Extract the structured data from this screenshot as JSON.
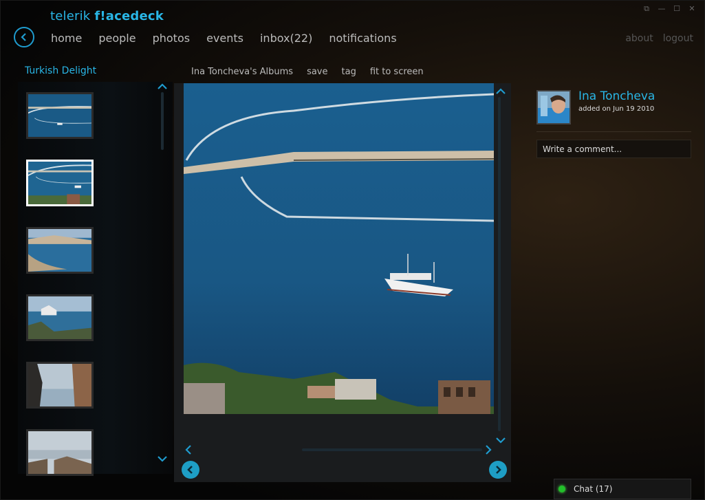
{
  "app": {
    "brand_prefix": "telerik ",
    "brand_name": "f!acedeck"
  },
  "nav": {
    "items": [
      "home",
      "people",
      "photos",
      "events",
      "inbox(22)",
      "notifications"
    ],
    "right": [
      "about",
      "logout"
    ]
  },
  "album": {
    "title": "Turkish Delight",
    "selected_index": 1
  },
  "toolbar": {
    "albums_link": "Ina Toncheva's Albums",
    "save": "save",
    "tag": "tag",
    "fit": "fit to screen"
  },
  "photo": {
    "author": "Ina Toncheva",
    "added_on": "added on Jun 19 2010",
    "comment_placeholder": "Write a comment..."
  },
  "chat": {
    "label": "Chat (17)",
    "status_color": "#22c02a"
  },
  "colors": {
    "accent": "#29b6e6",
    "background": "#050505"
  },
  "icons": [
    "back-icon",
    "scroll-up-icon",
    "scroll-down-icon",
    "prev-arrow-icon",
    "next-arrow-icon",
    "prev-circle-icon",
    "next-circle-icon",
    "minimize-icon",
    "maximize-icon",
    "close-icon",
    "restore-icon"
  ]
}
